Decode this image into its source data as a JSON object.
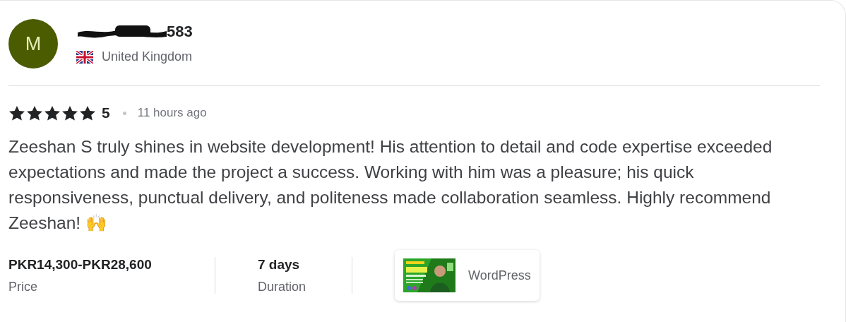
{
  "reviewer": {
    "avatar_letter": "M",
    "username_visible": "583",
    "country": "United Kingdom"
  },
  "review": {
    "stars": 5,
    "rating": "5",
    "time": "11 hours ago",
    "text": "Zeeshan S truly shines in website development! His attention to detail and code expertise exceeded expectations and made the project a success. Working with him was a pleasure; his quick responsiveness, punctual delivery, and politeness made collaboration seamless. Highly recommend Zeeshan! 🙌"
  },
  "details": [
    {
      "value": "PKR14,300-PKR28,600",
      "label": "Price"
    },
    {
      "value": "7 days",
      "label": "Duration"
    }
  ],
  "gig": {
    "category": "WordPress"
  }
}
